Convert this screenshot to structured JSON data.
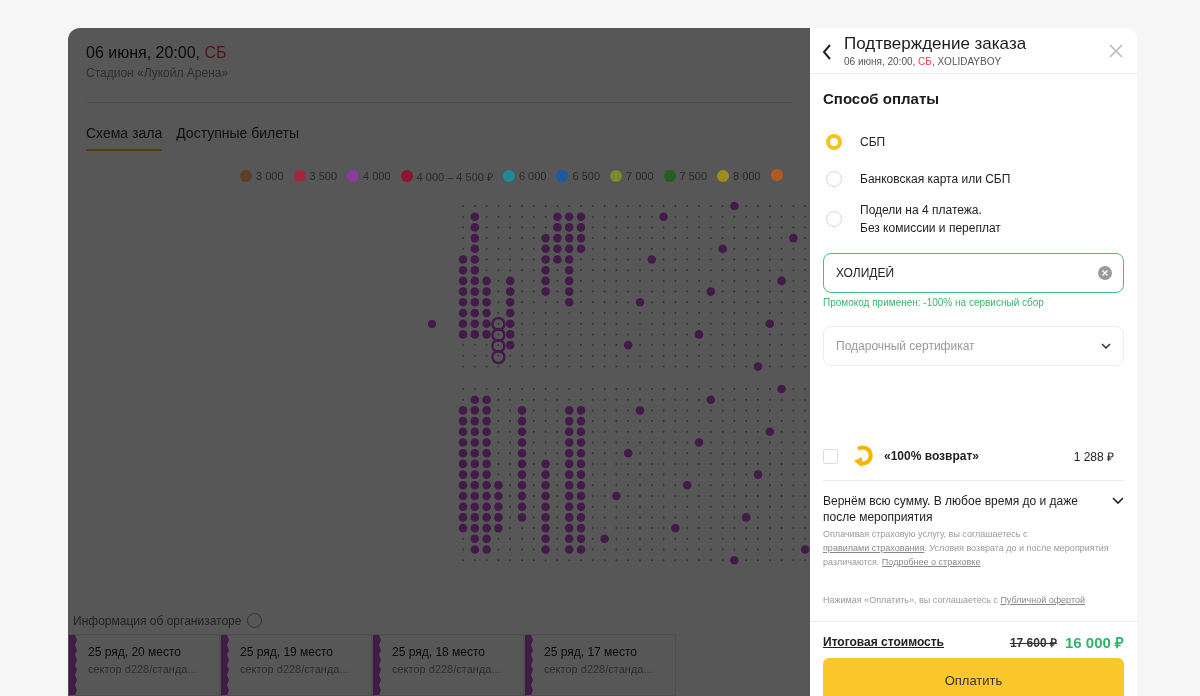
{
  "event": {
    "date": "06 июня, 20:00,",
    "weekday": "СБ",
    "venue": "Стадион «Лукойл Арена»"
  },
  "tabs": [
    {
      "label": "Схема зала",
      "selected": true
    },
    {
      "label": "Доступные билеты",
      "selected": false
    }
  ],
  "legend": [
    {
      "label": "3 000",
      "color": "#5c4028"
    },
    {
      "label": "3 500",
      "color": "#a02838"
    },
    {
      "label": "4 000",
      "color": "#8c3c9c"
    },
    {
      "label": "4 000 – 4 500 ₽",
      "color": "#8a1432"
    },
    {
      "label": "6 000",
      "color": "#1e8a94"
    },
    {
      "label": "6 500",
      "color": "#1c5aa0"
    },
    {
      "label": "7 000",
      "color": "#7a8c30"
    },
    {
      "label": "7 500",
      "color": "#235e22"
    },
    {
      "label": "8 000",
      "color": "#a08c1c"
    },
    {
      "color": "#b05a1e"
    }
  ],
  "organizer_info": "Информация об организаторе",
  "tickets": [
    {
      "title": "25 ряд, 20 место",
      "sector": "сектор d228/станда..."
    },
    {
      "title": "25 ряд, 19 место",
      "sector": "сектор d228/станда..."
    },
    {
      "title": "25 ряд, 18 место",
      "sector": "сектор d228/станда..."
    },
    {
      "title": "25 ряд, 17 место",
      "sector": "сектор d228/станда..."
    }
  ],
  "drawer": {
    "title": "Подтверждение заказа",
    "subtitle": {
      "date": "06 июня, 20:00,",
      "weekday": "СБ",
      "suffix": ", XOLIDAYBOY"
    },
    "payment_heading": "Способ оплаты",
    "payment_options": [
      {
        "label": "СБП",
        "selected": true
      },
      {
        "label": "Банковская карта или СБП",
        "selected": false
      },
      {
        "label": "Подели на 4 платежа.\nБез комиссии и переплат",
        "selected": false
      }
    ],
    "promo": {
      "value": "ХОЛИДЕЙ",
      "note": "Промокод применен: -100% на сервисный сбор"
    },
    "gift_certificate": {
      "placeholder": "Подарочный сертификат"
    },
    "insurance": {
      "checked": false,
      "label": "«100% возврат»",
      "price": "1 288 ₽",
      "summary": "Вернём всю сумму. В любое время до и даже после мероприятия",
      "expanded": false,
      "terms": [
        {
          "text": "Оплачивая страховую услугу, вы соглашаетесь с "
        },
        {
          "text": "правилами страхования",
          "link": true
        },
        {
          "text": ". Условия возврата до и после мероприятия различаются. "
        },
        {
          "text": "Подробнее о страховке",
          "link": true
        }
      ]
    },
    "offer": [
      {
        "text": "Нажимая «Оплатить», вы соглашаетесь с "
      },
      {
        "text": "Публичной офертой",
        "link": true
      }
    ],
    "total_label": "Итоговая стоимость",
    "old_price": "17 600 ₽",
    "price": "16 000 ₽",
    "pay_button": "Оплатить"
  }
}
